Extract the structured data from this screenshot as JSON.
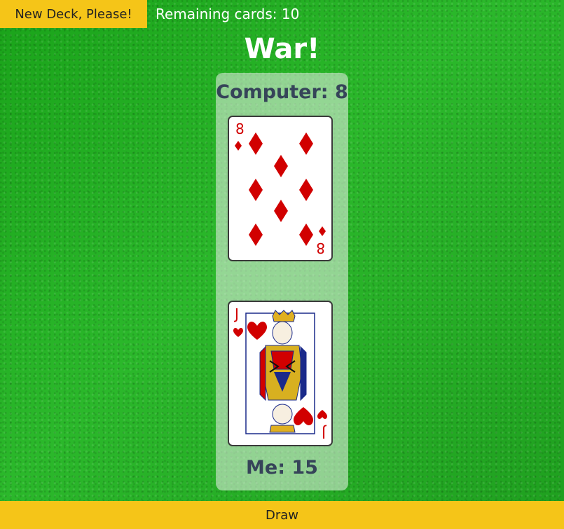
{
  "header": {
    "new_deck_label": "New Deck, Please!",
    "remaining_text": "Remaining cards: 10"
  },
  "title": "War!",
  "computer": {
    "label": "Computer: 8",
    "card": {
      "rank": "8",
      "suit": "diamonds",
      "color": "#d10000"
    }
  },
  "me": {
    "label": "Me: 15",
    "card": {
      "rank": "J",
      "suit": "hearts",
      "color": "#d10000"
    }
  },
  "footer": {
    "draw_label": "Draw"
  },
  "colors": {
    "button_yellow": "#f5c518",
    "table_green": "#2bb82b",
    "label_text": "#364459",
    "card_red": "#d10000"
  }
}
